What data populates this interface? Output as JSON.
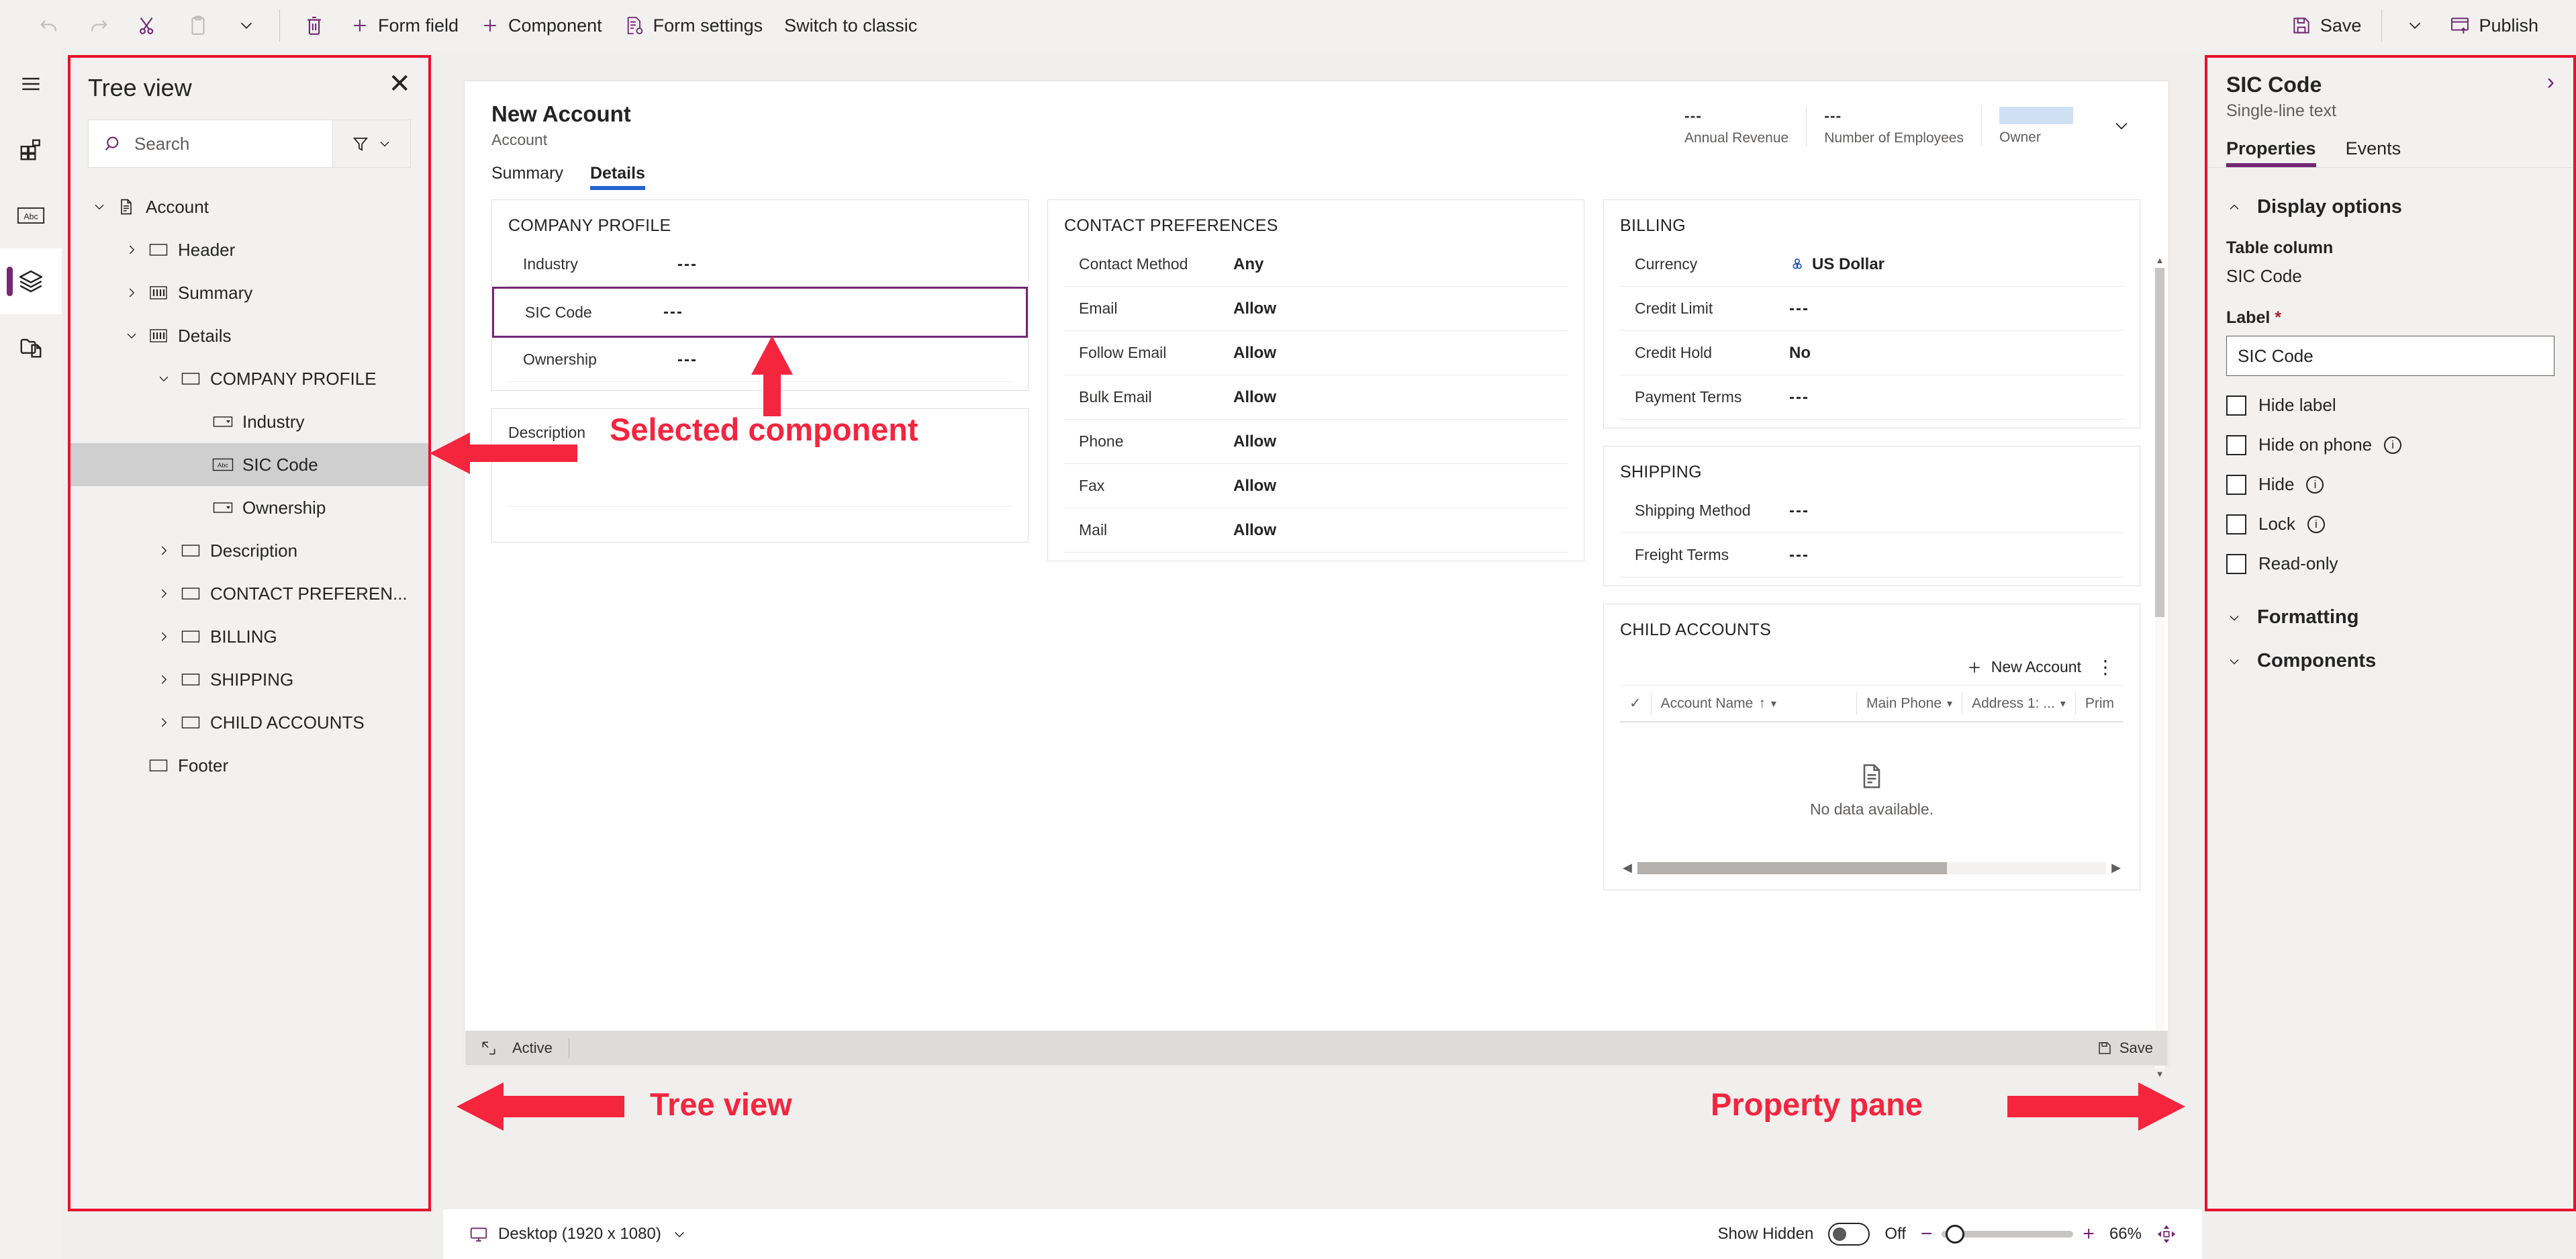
{
  "toolbar": {
    "undo": "Undo",
    "redo": "Redo",
    "cut": "Cut",
    "paste": "Paste",
    "more": "More",
    "delete": "Delete",
    "form_field": "Form field",
    "component": "Component",
    "form_settings": "Form settings",
    "switch_to_classic": "Switch to classic",
    "save": "Save",
    "save_more": "Save options",
    "publish": "Publish"
  },
  "rail": {
    "items": [
      {
        "name": "hamburger-menu-icon",
        "label": "Menu"
      },
      {
        "name": "components-icon",
        "label": "Components"
      },
      {
        "name": "table-columns-icon",
        "label": "Table columns"
      },
      {
        "name": "layers-icon",
        "label": "Tree view"
      },
      {
        "name": "related-forms-icon",
        "label": "Related forms"
      }
    ],
    "active_index": 3
  },
  "tree_view": {
    "title": "Tree view",
    "close_label": "Close",
    "search_placeholder": "Search",
    "search_value": "",
    "filter_label": "Filter",
    "nodes": [
      {
        "label": "Account",
        "indent": 0,
        "chevron": "down",
        "icon": "form-icon",
        "selected": false
      },
      {
        "label": "Header",
        "indent": 1,
        "chevron": "right",
        "icon": "section-icon",
        "selected": false
      },
      {
        "label": "Summary",
        "indent": 1,
        "chevron": "right",
        "icon": "tab-icon",
        "selected": false
      },
      {
        "label": "Details",
        "indent": 1,
        "chevron": "down",
        "icon": "tab-icon",
        "selected": false
      },
      {
        "label": "COMPANY PROFILE",
        "indent": 2,
        "chevron": "down",
        "icon": "section-icon",
        "selected": false
      },
      {
        "label": "Industry",
        "indent": 3,
        "chevron": "none",
        "icon": "choice-icon",
        "selected": false
      },
      {
        "label": "SIC Code",
        "indent": 3,
        "chevron": "none",
        "icon": "text-abc-icon",
        "selected": true
      },
      {
        "label": "Ownership",
        "indent": 3,
        "chevron": "none",
        "icon": "choice-icon",
        "selected": false
      },
      {
        "label": "Description",
        "indent": 2,
        "chevron": "right",
        "icon": "section-icon",
        "selected": false
      },
      {
        "label": "CONTACT PREFEREN...",
        "indent": 2,
        "chevron": "right",
        "icon": "section-icon",
        "selected": false
      },
      {
        "label": "BILLING",
        "indent": 2,
        "chevron": "right",
        "icon": "section-icon",
        "selected": false
      },
      {
        "label": "SHIPPING",
        "indent": 2,
        "chevron": "right",
        "icon": "section-icon",
        "selected": false
      },
      {
        "label": "CHILD ACCOUNTS",
        "indent": 2,
        "chevron": "right",
        "icon": "section-icon",
        "selected": false
      },
      {
        "label": "Footer",
        "indent": 1,
        "chevron": "none",
        "icon": "section-icon",
        "selected": false
      }
    ]
  },
  "form": {
    "title": "New Account",
    "subtitle": "Account",
    "header_fields": [
      {
        "value": "---",
        "label": "Annual Revenue"
      },
      {
        "value": "---",
        "label": "Number of Employees"
      },
      {
        "value": "",
        "label": "Owner"
      }
    ],
    "tabs": [
      {
        "label": "Summary",
        "active": false
      },
      {
        "label": "Details",
        "active": true
      }
    ],
    "sections": {
      "company_profile": {
        "title": "COMPANY PROFILE",
        "rows": [
          {
            "label": "Industry",
            "value": "---",
            "selected": false
          },
          {
            "label": "SIC Code",
            "value": "---",
            "selected": true
          },
          {
            "label": "Ownership",
            "value": "---",
            "selected": false
          }
        ]
      },
      "description": {
        "title": "Description"
      },
      "contact_preferences": {
        "title": "CONTACT PREFERENCES",
        "rows": [
          {
            "label": "Contact Method",
            "value": "Any"
          },
          {
            "label": "Email",
            "value": "Allow"
          },
          {
            "label": "Follow Email",
            "value": "Allow"
          },
          {
            "label": "Bulk Email",
            "value": "Allow"
          },
          {
            "label": "Phone",
            "value": "Allow"
          },
          {
            "label": "Fax",
            "value": "Allow"
          },
          {
            "label": "Mail",
            "value": "Allow"
          }
        ]
      },
      "billing": {
        "title": "BILLING",
        "currency_label": "Currency",
        "currency_value": "US Dollar",
        "rows": [
          {
            "label": "Credit Limit",
            "value": "---"
          },
          {
            "label": "Credit Hold",
            "value": "No"
          },
          {
            "label": "Payment Terms",
            "value": "---"
          }
        ]
      },
      "shipping": {
        "title": "SHIPPING",
        "rows": [
          {
            "label": "Shipping Method",
            "value": "---"
          },
          {
            "label": "Freight Terms",
            "value": "---"
          }
        ]
      },
      "child_accounts": {
        "title": "CHILD ACCOUNTS",
        "new_button": "New Account",
        "more_button": "More commands",
        "columns": [
          "Account Name",
          "Main Phone",
          "Address 1: ...",
          "Prim"
        ],
        "empty_message": "No data available."
      }
    },
    "footer": {
      "status": "Active",
      "save": "Save"
    }
  },
  "status_bar": {
    "device": "Desktop (1920 x 1080)",
    "show_hidden_label": "Show Hidden",
    "show_hidden_state": "Off",
    "zoom_out": "−",
    "zoom_in": "+",
    "zoom_level": "66%",
    "fit_label": "Fit to screen"
  },
  "property_pane": {
    "title": "SIC Code",
    "subtitle": "Single-line text",
    "expand_label": "Expand",
    "tabs": [
      {
        "label": "Properties",
        "active": true
      },
      {
        "label": "Events",
        "active": false
      }
    ],
    "display_options": {
      "group_title": "Display options",
      "table_column_label": "Table column",
      "table_column_value": "SIC Code",
      "label_label": "Label",
      "label_required": "*",
      "label_value": "SIC Code",
      "checkboxes": [
        {
          "label": "Hide label",
          "checked": false,
          "info": false
        },
        {
          "label": "Hide on phone",
          "checked": false,
          "info": true
        },
        {
          "label": "Hide",
          "checked": false,
          "info": true
        },
        {
          "label": "Lock",
          "checked": false,
          "info": true
        },
        {
          "label": "Read-only",
          "checked": false,
          "info": false
        }
      ]
    },
    "groups": [
      {
        "title": "Formatting",
        "expanded": false
      },
      {
        "title": "Components",
        "expanded": false
      }
    ]
  },
  "annotations": [
    {
      "text": "Selected component"
    },
    {
      "text": "Tree view"
    },
    {
      "text": "Property pane"
    }
  ],
  "colors": {
    "accent_purple": "#742774",
    "annotation_red": "#f5253e",
    "tab_blue": "#2266cc",
    "link_blue": "#1a51b5"
  }
}
